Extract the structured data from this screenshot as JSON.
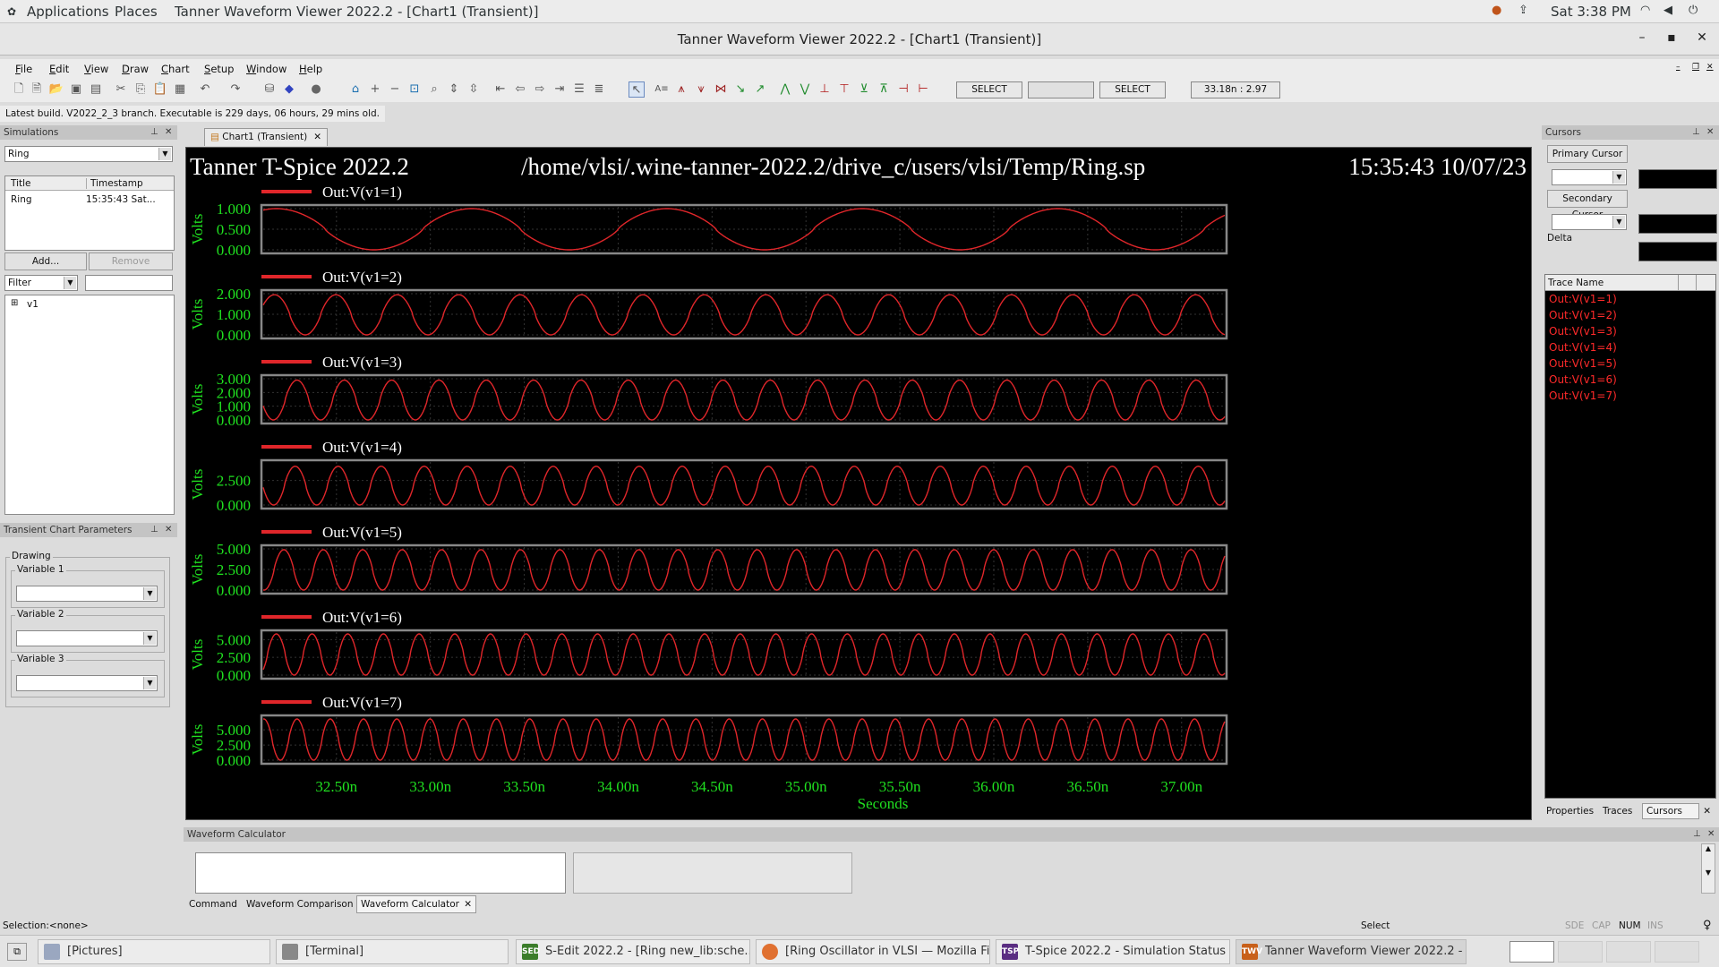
{
  "topbar": {
    "applications": "Applications",
    "places": "Places",
    "window_title": "Tanner Waveform Viewer 2022.2 - [Chart1 (Transient)]",
    "clock": "Sat  3:38 PM"
  },
  "window": {
    "title": "Tanner Waveform Viewer 2022.2 - [Chart1 (Transient)]",
    "minimize": "–",
    "maximize": "▪",
    "close": "✕"
  },
  "menu": [
    "File",
    "Edit",
    "View",
    "Draw",
    "Chart",
    "Setup",
    "Window",
    "Help"
  ],
  "toolbar": {
    "select1": "SELECT",
    "select2": "SELECT",
    "readout": "33.18n : 2.97"
  },
  "message": "Latest build. V2022_2_3 branch. Executable is 229 days, 06 hours, 29 mins old.",
  "simulations": {
    "header": "Simulations",
    "combo_value": "Ring",
    "col_title": "Title",
    "col_timestamp": "Timestamp",
    "row_title": "Ring",
    "row_timestamp": "15:35:43 Sat...",
    "add": "Add...",
    "remove": "Remove",
    "filter": "Filter",
    "tree_item": "v1",
    "tree_expand": "⊞"
  },
  "params": {
    "header": "Transient Chart Parameters",
    "drawing": "Drawing",
    "var1": "Variable 1",
    "var2": "Variable 2",
    "var3": "Variable 3"
  },
  "chart_tab": "Chart1 (Transient)",
  "chart": {
    "header_left": "Tanner T-Spice 2022.2",
    "header_mid": "/home/vlsi/.wine-tanner-2022.2/drive_c/users/vlsi/Temp/Ring.sp",
    "header_right": "15:35:43 10/07/23",
    "ylabel": "Volts",
    "xlabel": "Seconds"
  },
  "chart_data": {
    "type": "line",
    "title": "Tanner T-Spice 2022.2",
    "xlabel": "Seconds",
    "ylabel": "Volts",
    "xlim": [
      3.211e-08,
      3.723e-08
    ],
    "x_ticks": [
      "32.50n",
      "33.00n",
      "33.50n",
      "34.00n",
      "34.50n",
      "35.00n",
      "35.50n",
      "36.00n",
      "36.50n",
      "37.00n"
    ],
    "x_tick_values": [
      3.25e-08,
      3.3e-08,
      3.35e-08,
      3.4e-08,
      3.45e-08,
      3.5e-08,
      3.55e-08,
      3.6e-08,
      3.65e-08,
      3.7e-08
    ],
    "grid": true,
    "color": "#e0262a",
    "series": [
      {
        "name": "Out:V(v1=1)",
        "ylim": [
          0,
          1.0
        ],
        "yticks": [
          "1.000",
          "0.500",
          "0.000"
        ],
        "ytick_values": [
          1.0,
          0.5,
          0.0
        ],
        "amplitude_max": 1.0,
        "amplitude_min": 0.0,
        "period_ns": 1.04,
        "first_peak_ns": 33.22
      },
      {
        "name": "Out:V(v1=2)",
        "ylim": [
          0,
          2.0
        ],
        "yticks": [
          "2.000",
          "1.000",
          "0.000"
        ],
        "ytick_values": [
          2.0,
          1.0,
          0.0
        ],
        "amplitude_max": 1.95,
        "amplitude_min": 0.0,
        "period_ns": 0.327,
        "first_peak_ns": 32.17
      },
      {
        "name": "Out:V(v1=3)",
        "ylim": [
          0,
          3.0
        ],
        "yticks": [
          "3.000",
          "2.000",
          "1.000",
          "0.000"
        ],
        "ytick_values": [
          3.0,
          2.0,
          1.0,
          0.0
        ],
        "amplitude_max": 2.9,
        "amplitude_min": 0.0,
        "period_ns": 0.252,
        "first_peak_ns": 32.29
      },
      {
        "name": "Out:V(v1=4)",
        "ylim": [
          0,
          4.2
        ],
        "yticks": [
          "2.500",
          "0.000"
        ],
        "ytick_values": [
          2.5,
          0.0
        ],
        "amplitude_max": 3.95,
        "amplitude_min": 0.0,
        "period_ns": 0.229,
        "first_peak_ns": 32.28
      },
      {
        "name": "Out:V(v1=5)",
        "ylim": [
          0,
          5.0
        ],
        "yticks": [
          "5.000",
          "2.500",
          "0.000"
        ],
        "ytick_values": [
          5.0,
          2.5,
          0.0
        ],
        "amplitude_max": 4.9,
        "amplitude_min": 0.0,
        "period_ns": 0.21,
        "first_peak_ns": 32.22
      },
      {
        "name": "Out:V(v1=6)",
        "ylim": [
          0,
          5.8
        ],
        "yticks": [
          "5.000",
          "2.500",
          "0.000"
        ],
        "ytick_values": [
          5.0,
          2.5,
          0.0
        ],
        "amplitude_max": 5.8,
        "amplitude_min": 0.0,
        "period_ns": 0.19,
        "first_peak_ns": 32.18
      },
      {
        "name": "Out:V(v1=7)",
        "ylim": [
          0,
          6.8
        ],
        "yticks": [
          "5.000",
          "2.500",
          "0.000"
        ],
        "ytick_values": [
          5.0,
          2.5,
          0.0
        ],
        "amplitude_max": 6.8,
        "amplitude_min": 0.0,
        "period_ns": 0.177,
        "first_peak_ns": 32.29
      }
    ]
  },
  "cursors": {
    "header": "Cursors",
    "primary": "Primary Cursor",
    "secondary": "Secondary Cursor",
    "delta": "Delta",
    "trace_col": "Trace Name",
    "traces": [
      "Out:V(v1=1)",
      "Out:V(v1=2)",
      "Out:V(v1=3)",
      "Out:V(v1=4)",
      "Out:V(v1=5)",
      "Out:V(v1=6)",
      "Out:V(v1=7)"
    ],
    "tab_properties": "Properties",
    "tab_traces": "Traces",
    "tab_cursors": "Cursors"
  },
  "calculator": {
    "header": "Waveform Calculator",
    "tab_command": "Command",
    "tab_comparison": "Waveform Comparison",
    "tab_calculator": "Waveform Calculator"
  },
  "status": {
    "selection": "Selection:<none>",
    "mode": "Select",
    "sde": "SDE",
    "cap": "CAP",
    "num": "NUM",
    "ins": "INS"
  },
  "taskbar": [
    {
      "label": "[Pictures]",
      "badge": ""
    },
    {
      "label": "[Terminal]",
      "badge": ""
    },
    {
      "label": "S-Edit 2022.2 - [Ring new_lib:sche...",
      "badge": "SED"
    },
    {
      "label": "[Ring Oscillator in VLSI — Mozilla Fir...",
      "badge": ""
    },
    {
      "label": "T-Spice 2022.2 - Simulation Status",
      "badge": "TSP"
    },
    {
      "label": "Tanner Waveform Viewer 2022.2 - ...",
      "badge": "TWV"
    }
  ]
}
